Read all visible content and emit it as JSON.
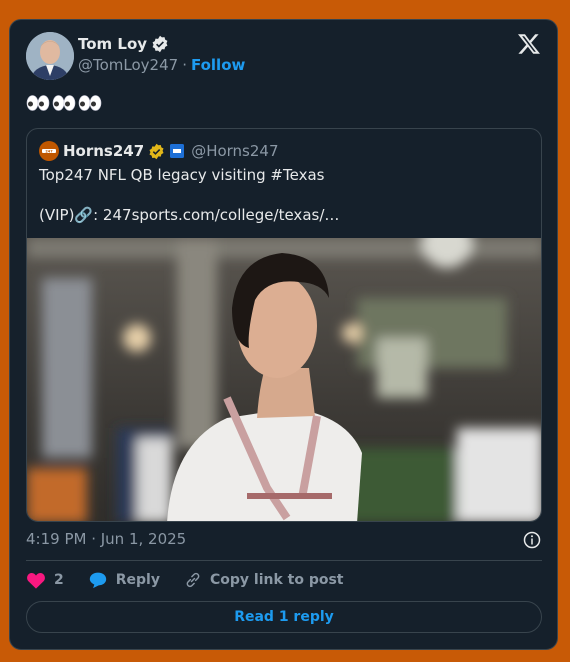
{
  "author": {
    "name": "Tom Loy",
    "handle": "@TomLoy247",
    "separator": "·",
    "follow_label": "Follow",
    "verified_color": "#e7e9ea"
  },
  "tweet": {
    "emoji_text": "👀👀👀"
  },
  "quoted": {
    "name": "Horns247",
    "handle": "@Horns247",
    "verified_color": "#e2b719",
    "line1": "Top247 NFL QB legacy visiting #Texas",
    "line2": "(VIP)🔗: 247sports.com/college/texas/…",
    "image": "photo-young-man-in-white-shirt-indoor-facility"
  },
  "meta": {
    "timestamp": "4:19 PM · Jun 1, 2025"
  },
  "actions": {
    "like_count": "2",
    "reply_label": "Reply",
    "copy_label": "Copy link to post",
    "read_reply_label": "Read 1 reply"
  },
  "colors": {
    "background": "#c85a06",
    "card": "#15202b",
    "accent": "#1d9bf0",
    "heart": "#f91880",
    "muted": "#8b98a5"
  }
}
